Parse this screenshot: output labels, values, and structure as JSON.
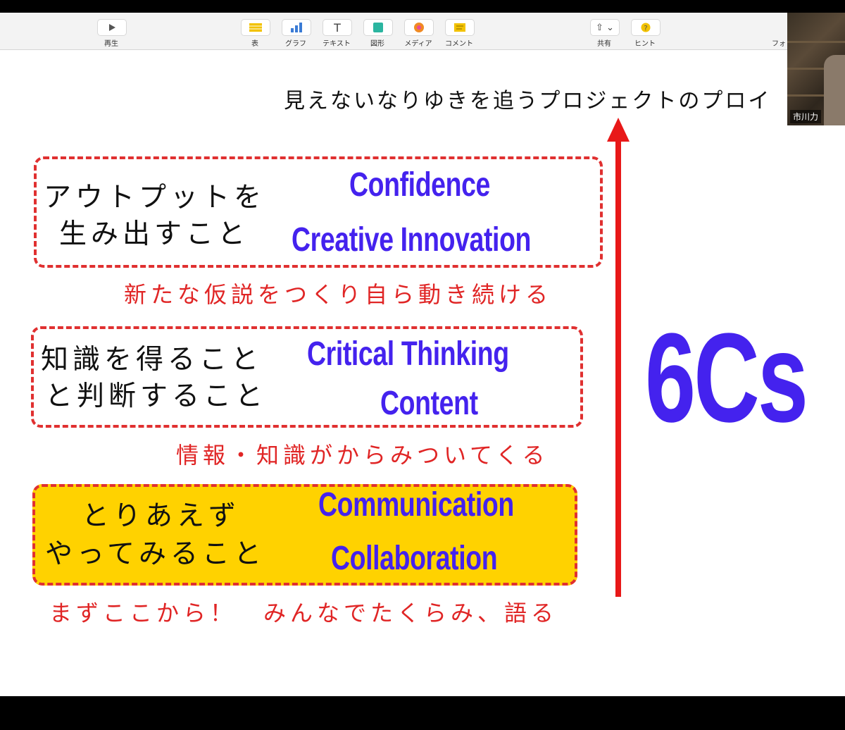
{
  "toolbar": {
    "play": "再生",
    "table": "表",
    "chart": "グラフ",
    "text": "テキスト",
    "shape": "図形",
    "media": "メディア",
    "comment": "コメント",
    "share": "共有",
    "hint": "ヒント",
    "format_partial": "フォ"
  },
  "video": {
    "participant_name": "市川力"
  },
  "slide": {
    "title": "見えないなりゆきを追うプロジェクトのプロイ",
    "sections": [
      {
        "jp_lines": [
          "アウトプットを",
          "生み出すこと"
        ],
        "en": [
          "Confidence",
          "Creative Innovation"
        ],
        "caption": "新たな仮説をつくり自ら動き続ける"
      },
      {
        "jp_lines": [
          "知識を得ること",
          "と判断すること"
        ],
        "en": [
          "Critical Thinking",
          "Content"
        ],
        "caption": "情報・知識がからみついてくる"
      },
      {
        "jp_lines": [
          "とりあえず",
          "やってみること"
        ],
        "en": [
          "Communication",
          "Collaboration"
        ],
        "caption": "まずここから！　みんなでたくらみ、語る"
      }
    ],
    "big_label": "6Cs",
    "colors": {
      "accent_blue": "#4422ee",
      "red": "#e02525",
      "highlight": "#ffd200"
    }
  }
}
